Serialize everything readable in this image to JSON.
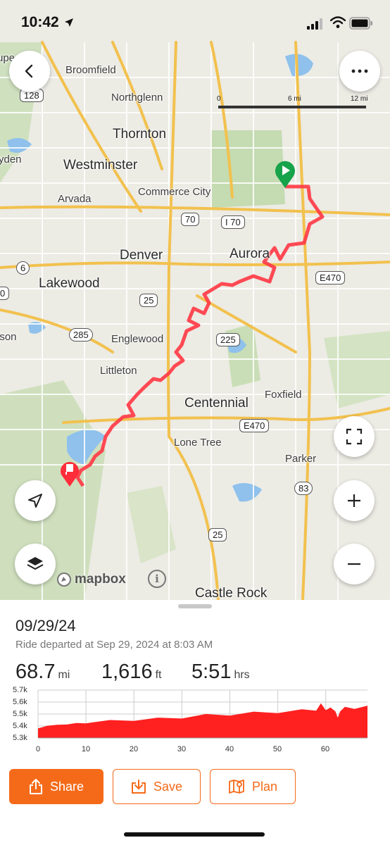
{
  "status_bar": {
    "time": "10:42"
  },
  "map": {
    "scale": {
      "labels": [
        "0",
        "6 mi",
        "12 mi"
      ]
    },
    "places": {
      "broomfield": "Broomfield",
      "northglenn": "Northglenn",
      "thornton": "Thornton",
      "westminster": "Westminster",
      "commerce_city": "Commerce City",
      "arvada": "Arvada",
      "denver": "Denver",
      "aurora": "Aurora",
      "lakewood": "Lakewood",
      "englewood": "Englewood",
      "littleton": "Littleton",
      "centennial": "Centennial",
      "foxfield": "Foxfield",
      "lone_tree": "Lone Tree",
      "parker": "Parker",
      "castle_rock": "Castle Rock",
      "edge_left_1": "ydеn",
      "edge_left_2": "ison",
      "edge_left_3": "upe"
    },
    "highways": {
      "h128": "128",
      "h70": "70",
      "i70": "I 70",
      "h6": "6",
      "h0": "0",
      "e470_east": "E470",
      "h25_north": "25",
      "h285": "285",
      "h225": "225",
      "e470_south": "E470",
      "h83": "83",
      "h25_south": "25"
    },
    "attribution": "mapbox",
    "route_color": "#ff3b46",
    "start_color": "#17a34a",
    "end_color": "#ff2d3a"
  },
  "ride": {
    "date": "09/29/24",
    "departed": "Ride departed at Sep 29, 2024 at 8:03 AM",
    "distance": {
      "value": "68.7",
      "unit": "mi"
    },
    "elevation_gain": {
      "value": "1,616",
      "unit": "ft"
    },
    "duration": {
      "value": "5:51",
      "unit": "hrs"
    }
  },
  "chart_data": {
    "type": "area",
    "y_tick_labels": [
      "5.7k",
      "5.6k",
      "5.5k",
      "5.4k",
      "5.3k"
    ],
    "x_tick_labels": [
      "0",
      "10",
      "20",
      "30",
      "40",
      "50",
      "60"
    ],
    "ylim": [
      5300,
      5700
    ],
    "xlim": [
      0,
      68.7
    ],
    "x": [
      0,
      2,
      4,
      6,
      8,
      10,
      15,
      20,
      25,
      30,
      35,
      40,
      45,
      50,
      55,
      58,
      59,
      60,
      61,
      62,
      62.5,
      63,
      64,
      66,
      68.7
    ],
    "y": [
      5380,
      5420,
      5410,
      5430,
      5425,
      5440,
      5450,
      5460,
      5470,
      5480,
      5500,
      5505,
      5520,
      5525,
      5540,
      5545,
      5590,
      5550,
      5555,
      5540,
      5470,
      5540,
      5560,
      5560,
      5570
    ],
    "color": "#ff2020",
    "grid": true
  },
  "actions": {
    "share": "Share",
    "save": "Save",
    "plan": "Plan"
  }
}
